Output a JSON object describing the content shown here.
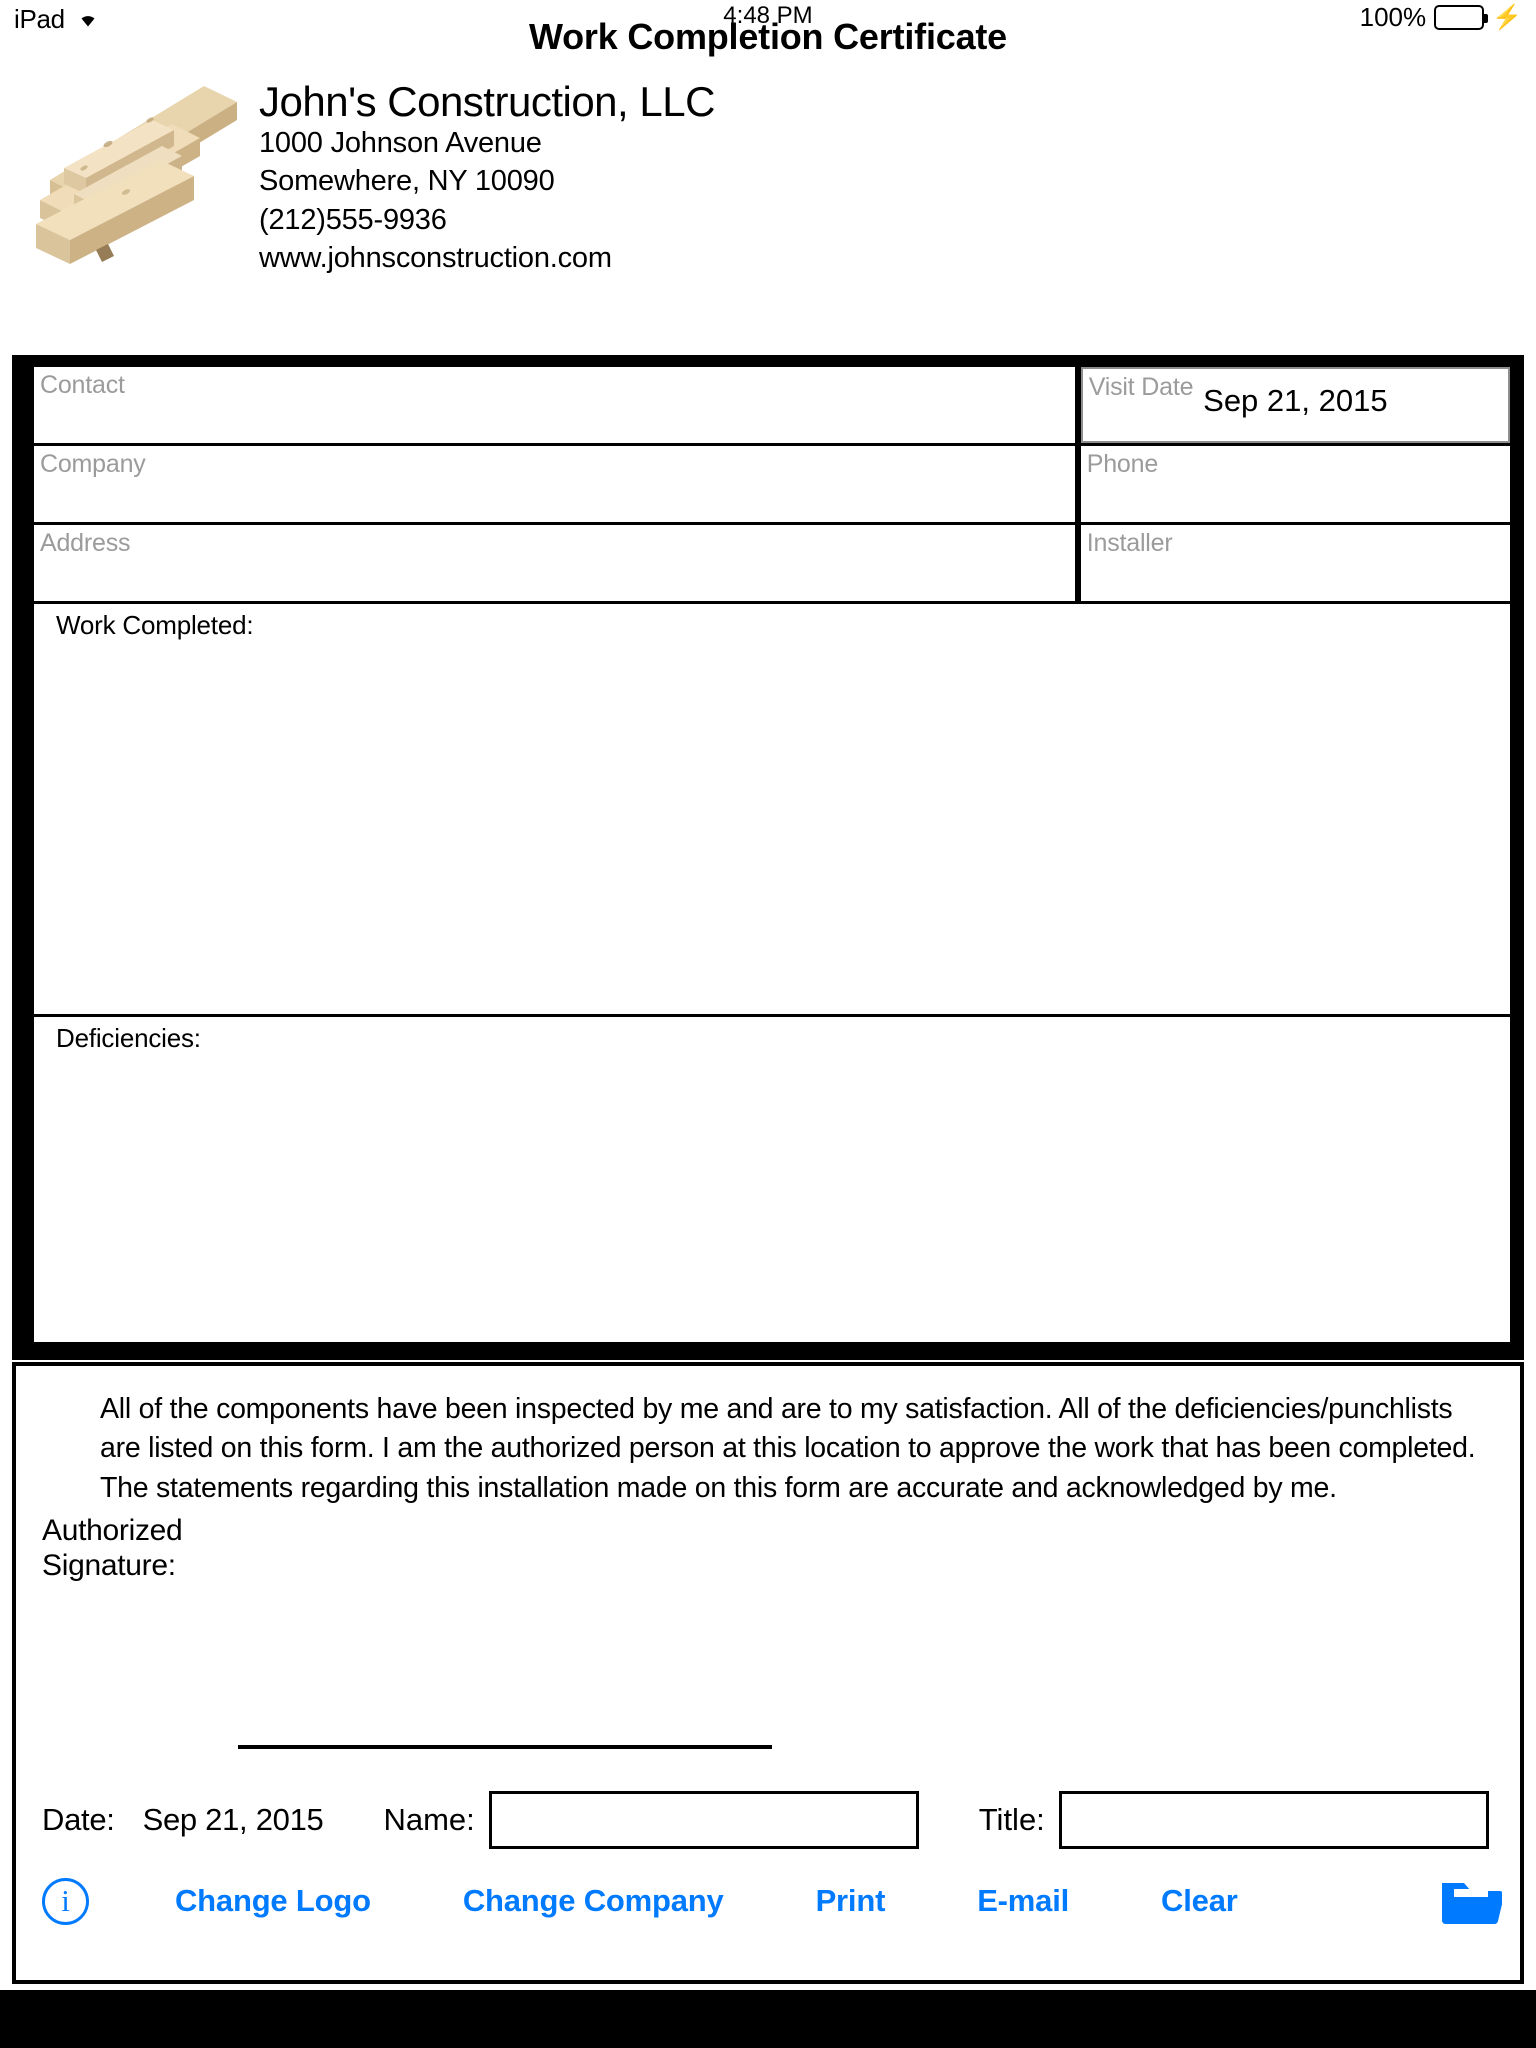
{
  "status_bar": {
    "device": "iPad",
    "wifi_icon": "wifi-icon",
    "time": "4:48 PM",
    "battery_percent": "100%",
    "battery_level": 100,
    "battery_color": "#4CD964",
    "charging_icon": "lightning-bolt-icon"
  },
  "page_title": "Work Completion Certificate",
  "company": {
    "logo_alt": "lumber-stack-logo",
    "name": "John's Construction, LLC",
    "address_line1": "1000 Johnson Avenue",
    "address_line2": "Somewhere, NY 10090",
    "phone": "(212)555-9936",
    "website": "www.johnsconstruction.com"
  },
  "form": {
    "left_fields": [
      {
        "placeholder": "Contact",
        "value": ""
      },
      {
        "placeholder": "Company",
        "value": ""
      },
      {
        "placeholder": "Address",
        "value": ""
      }
    ],
    "right_fields": [
      {
        "placeholder": "Visit Date",
        "value": "Sep 21, 2015"
      },
      {
        "placeholder": "Phone",
        "value": ""
      },
      {
        "placeholder": "Installer",
        "value": ""
      }
    ],
    "work_completed_label": "Work Completed:",
    "work_completed_value": "",
    "deficiencies_label": "Deficiencies:",
    "deficiencies_value": ""
  },
  "certification": {
    "statement": "All of the components have been inspected by me and are to my satisfaction. All of the deficiencies/punchlists are listed on this form. I am the authorized person at this location to approve the work that has been completed. The statements regarding this installation made on this form are accurate and acknowledged by me.",
    "signature_label_line1": "Authorized",
    "signature_label_line2": "Signature:",
    "signature_value": "",
    "date_label": "Date:",
    "date_value": "Sep 21, 2015",
    "name_label": "Name:",
    "name_value": "",
    "title_label": "Title:",
    "title_value": ""
  },
  "toolbar": {
    "accent_color": "#007AFF",
    "info_icon": "info-circle-icon",
    "info_glyph": "i",
    "change_logo_label": "Change Logo",
    "change_company_label": "Change Company",
    "print_label": "Print",
    "email_label": "E-mail",
    "clear_label": "Clear",
    "folder_icon": "folder-icon"
  }
}
